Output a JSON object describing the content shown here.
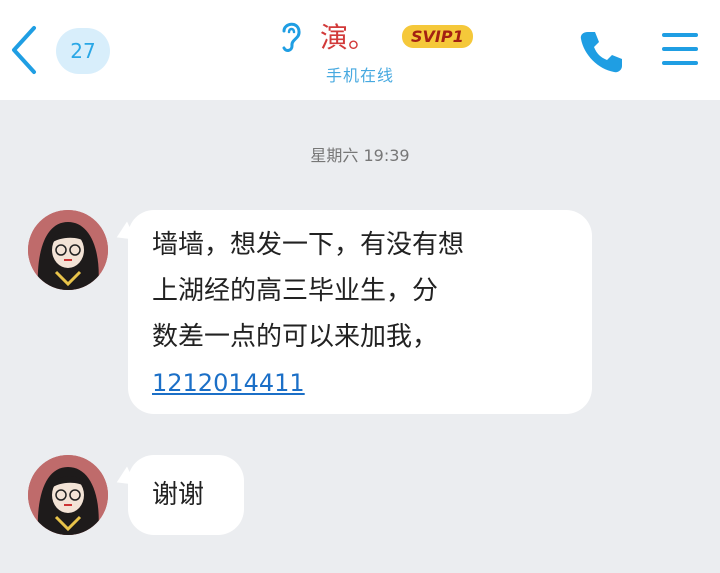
{
  "header": {
    "unread_count": "27",
    "contact_name": "演。",
    "vip_badge": "SVIP1",
    "status": "手机在线",
    "icons": [
      "back-arrow-icon",
      "ear-icon",
      "phone-icon",
      "menu-icon"
    ]
  },
  "chat": {
    "timestamp": "星期六 19:39",
    "messages": [
      {
        "text": "墙墙，想发一下，有没有想\n上湖经的高三毕业生，分\n数差一点的可以来加我，",
        "link": "1212014411"
      },
      {
        "text": "谢谢"
      }
    ]
  },
  "colors": {
    "accent": "#1f9ee3",
    "background": "#ebedf0",
    "name_red": "#d23a3a",
    "vip_gold": "#f5c83a"
  }
}
